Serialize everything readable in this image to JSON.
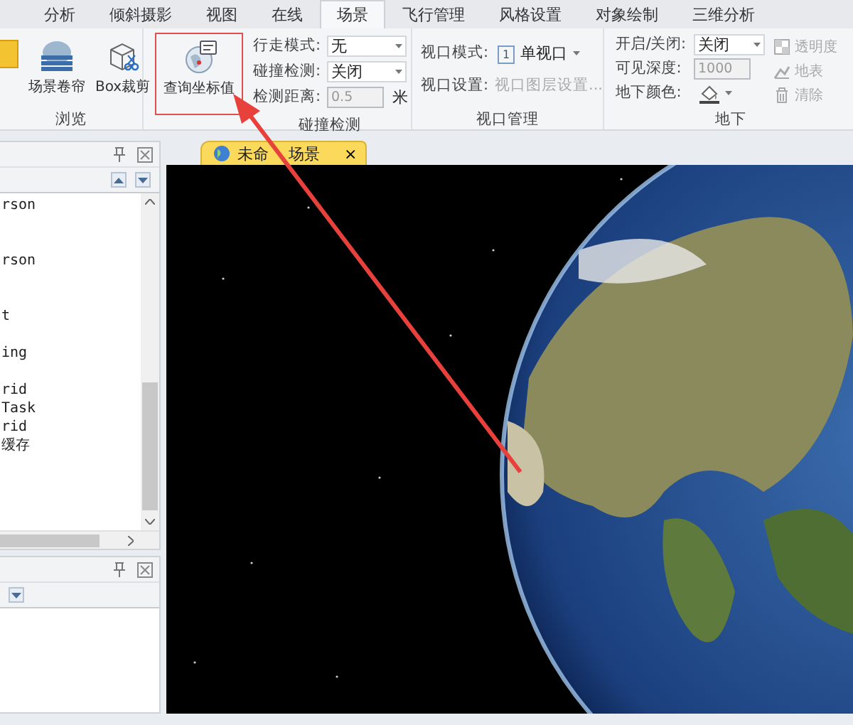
{
  "ribbon": {
    "tabs": [
      {
        "label": "分析",
        "selected": false
      },
      {
        "label": "倾斜摄影",
        "selected": false
      },
      {
        "label": "视图",
        "selected": false
      },
      {
        "label": "在线",
        "selected": false
      },
      {
        "label": "场景",
        "selected": true
      },
      {
        "label": "飞行管理",
        "selected": false
      },
      {
        "label": "风格设置",
        "selected": false
      },
      {
        "label": "对象绘制",
        "selected": false
      },
      {
        "label": "三维分析",
        "selected": false
      }
    ],
    "browse_group": {
      "label": "浏览",
      "buttons": [
        {
          "kind": "highlight"
        },
        {
          "kind": "curtain",
          "label": "场景卷帘"
        },
        {
          "kind": "box-clip",
          "label": "Box裁剪"
        }
      ]
    },
    "collision_group": {
      "label": "碰撞检测",
      "query_button": {
        "label": "查询坐标值",
        "highlighted": true
      },
      "fields": [
        {
          "kind": "dropdown",
          "label": "行走模式:",
          "value": "无",
          "disabled": false
        },
        {
          "kind": "dropdown",
          "label": "碰撞检测:",
          "value": "关闭",
          "disabled": false
        },
        {
          "kind": "input",
          "label": "检测距离:",
          "value": "0.5",
          "unit": "米",
          "disabled": true
        }
      ]
    },
    "viewport_group": {
      "label": "视口管理",
      "fields": [
        {
          "kind": "dropdown",
          "label": "视口模式:",
          "badge": "1",
          "value": "单视口",
          "disabled": false
        },
        {
          "kind": "link",
          "label": "视口设置:",
          "value": "视口图层设置...",
          "disabled": true
        }
      ]
    },
    "underground_group": {
      "label": "地下",
      "fields": [
        {
          "kind": "dropdown",
          "label": "开启/关闭:",
          "value": "关闭",
          "disabled": false
        },
        {
          "kind": "input",
          "label": "可见深度:",
          "value": "1000",
          "disabled": true
        },
        {
          "kind": "color",
          "label": "地下颜色:",
          "disabled": false
        }
      ],
      "actions": [
        {
          "kind": "transparency",
          "label": "透明度",
          "disabled": true
        },
        {
          "kind": "terrain",
          "label": "地表",
          "disabled": true
        },
        {
          "kind": "clear",
          "label": "清除",
          "disabled": true
        }
      ]
    }
  },
  "output_panel": {
    "lines": [
      "rson",
      "rson",
      "t",
      "ing",
      "rid",
      "Task",
      "rid",
      "缓存"
    ]
  },
  "scene_tab": {
    "label_parts": [
      "未命",
      "场景"
    ],
    "close": "×",
    "selected": true
  }
}
